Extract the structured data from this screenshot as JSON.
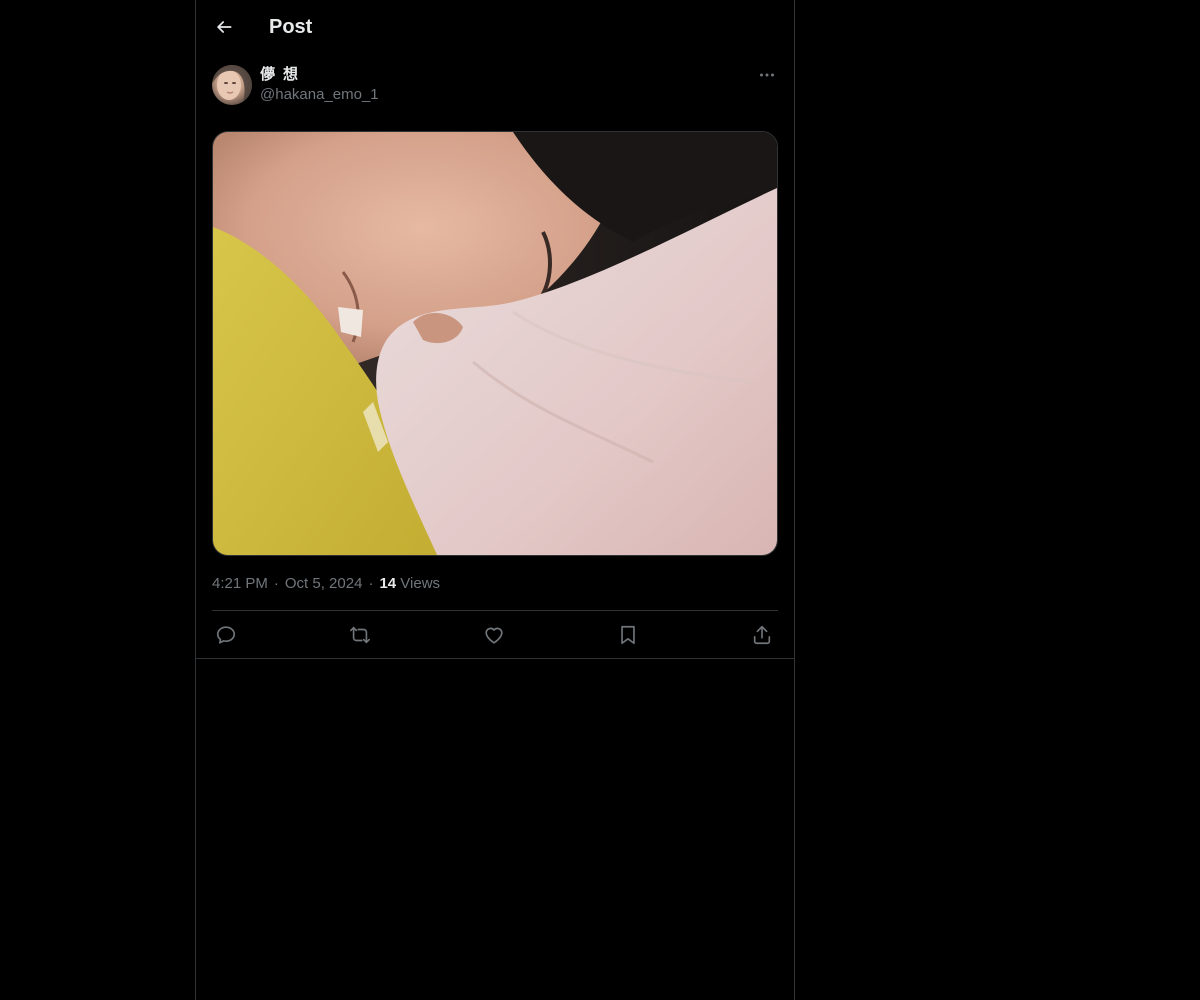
{
  "header": {
    "back_icon": "arrow-left-icon",
    "title": "Post"
  },
  "post": {
    "author": {
      "display_name": "儚想",
      "handle": "@hakana_emo_1",
      "avatar_icon": "avatar-photo"
    },
    "more_icon": "ellipsis-icon",
    "media": {
      "icon": "photo-sleeping-person-in-blankets"
    },
    "meta": {
      "time": "4:21 PM",
      "separator": "·",
      "date": "Oct 5, 2024",
      "views_count": "14",
      "views_label": "Views"
    },
    "actions": [
      {
        "name": "reply",
        "icon": "reply-icon"
      },
      {
        "name": "repost",
        "icon": "repost-icon"
      },
      {
        "name": "like",
        "icon": "heart-icon"
      },
      {
        "name": "bookmark",
        "icon": "bookmark-icon"
      },
      {
        "name": "share",
        "icon": "share-icon"
      }
    ]
  },
  "colors": {
    "background": "#000000",
    "text_primary": "#e7e9ea",
    "text_secondary": "#71767b",
    "border": "#2f3336"
  }
}
